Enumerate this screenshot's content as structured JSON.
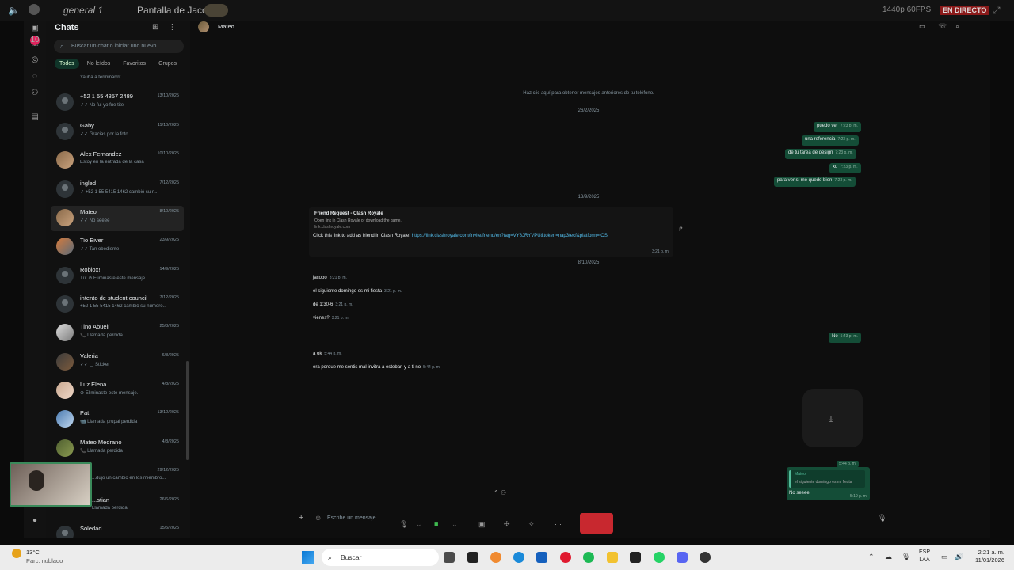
{
  "stream": {
    "channel": "general 1",
    "screen_title": "Pantalla de Jacob",
    "quality": "1440p 60FPS",
    "live_label": "EN DIRECTO"
  },
  "rail": {
    "unread_badge": "10"
  },
  "sidebar": {
    "title": "Chats",
    "search_placeholder": "Buscar un chat o iniciar uno nuevo",
    "filters": [
      "Todos",
      "No leídos",
      "Favoritos",
      "Grupos"
    ],
    "chats": [
      {
        "name": "",
        "preview": "Ya iba a terminarrrr",
        "date": ""
      },
      {
        "name": "+52 1 55 4857 2489",
        "preview": "✓✓ No fui yo fue tite",
        "date": "13/10/2025"
      },
      {
        "name": "Gaby",
        "preview": "✓✓ Gracias por la foto",
        "date": "11/10/2025"
      },
      {
        "name": "Alex Fernandez",
        "preview": "Estoy en la entrada de la casa",
        "date": "10/10/2025"
      },
      {
        "name": "ingled",
        "preview": "✓ +52 1 55 5415 1462 cambió su n...",
        "date": "7/12/2025"
      },
      {
        "name": "Mateo",
        "preview": "✓✓ No seeee",
        "date": "8/10/2025"
      },
      {
        "name": "Tio Eiver",
        "preview": "✓✓ Tan obediente",
        "date": "23/9/2025"
      },
      {
        "name": "Roblox!!",
        "preview": "Tú: ⊘ Eliminaste este mensaje.",
        "date": "14/9/2025"
      },
      {
        "name": "intento de student council",
        "preview": "+52 1 55 5415 1462 cambió su número...",
        "date": "7/12/2025"
      },
      {
        "name": "Tino Abuelí",
        "preview": "📞 Llamada perdida",
        "date": "25/8/2025"
      },
      {
        "name": "Valeria",
        "preview": "✓✓ ▢ Sticker",
        "date": "6/8/2025"
      },
      {
        "name": "Luz Elena",
        "preview": "⊘ Eliminaste este mensaje.",
        "date": "4/8/2025"
      },
      {
        "name": "Pat",
        "preview": "📹 Llamada grupal perdida",
        "date": "13/12/2025"
      },
      {
        "name": "Mateo Medrano",
        "preview": "📞 Llamada perdida",
        "date": "4/8/2025"
      },
      {
        "name": "",
        "preview": "...dujo un cambio en los miembro...",
        "date": "29/12/2025"
      },
      {
        "name": "...stian",
        "preview": "Llamada perdida",
        "date": "26/6/2025"
      },
      {
        "name": "Soledad",
        "preview": "",
        "date": "15/5/2025"
      }
    ]
  },
  "conversation": {
    "contact": "Mateo",
    "load_older": "Haz clic aquí para obtener mensajes anteriores de tu teléfono.",
    "date1": "26/2/2025",
    "outgoing1": [
      {
        "text": "puedo ver",
        "time": "7:23 p. m."
      },
      {
        "text": "una referencia",
        "time": "7:23 p. m."
      },
      {
        "text": "de tu tarea de design",
        "time": "7:23 p. m."
      },
      {
        "text": "xd",
        "time": "7:23 p. m."
      },
      {
        "text": "para ver si me quedo bien",
        "time": "7:23 p. m."
      }
    ],
    "date2": "13/9/2025",
    "card": {
      "title": "Friend Request - Clash Royale",
      "sub1": "Open link in Clash Royale or download the game.",
      "sub2": "link.clashroyale.com",
      "body": "Click this link to add as friend in Clash Royale!",
      "link": "https://link.clashroyale.com/invite/friend/en?tag=VY8JRYVPU&token=nap3tecf&platform=iOS",
      "time": "3:21 p. m."
    },
    "date3": "8/10/2025",
    "incoming1": [
      {
        "text": "jacobo",
        "time": "3:21 p. m."
      },
      {
        "text": "el siguiente domingo es mi fiesta",
        "time": "3:21 p. m."
      },
      {
        "text": "de 1:30-6",
        "time": "3:21 p. m."
      },
      {
        "text": "vienes?",
        "time": "3:21 p. m."
      }
    ],
    "outgoing2": {
      "text": "No",
      "time": "5:43 p. m."
    },
    "incoming2": [
      {
        "text": "a ok",
        "time": "5:44 p. m."
      },
      {
        "text": "era porque me sentis mal invitra a esteban y a ti no",
        "time": "5:44 p. m."
      }
    ],
    "reply_top_time": "5:44 p. m.",
    "reply": {
      "author": "Mateo",
      "quoted": "el siguiente domingo es mi fiesta",
      "text": "No seeee",
      "time": "5:19 p. m."
    },
    "compose_placeholder": "Escribe un mensaje"
  },
  "taskbar": {
    "temp": "13°C",
    "weather": "Parc. nublado",
    "search": "Buscar",
    "lang1": "ESP",
    "lang2": "LAA",
    "time": "2:21 a. m.",
    "date": "11/01/2026"
  }
}
